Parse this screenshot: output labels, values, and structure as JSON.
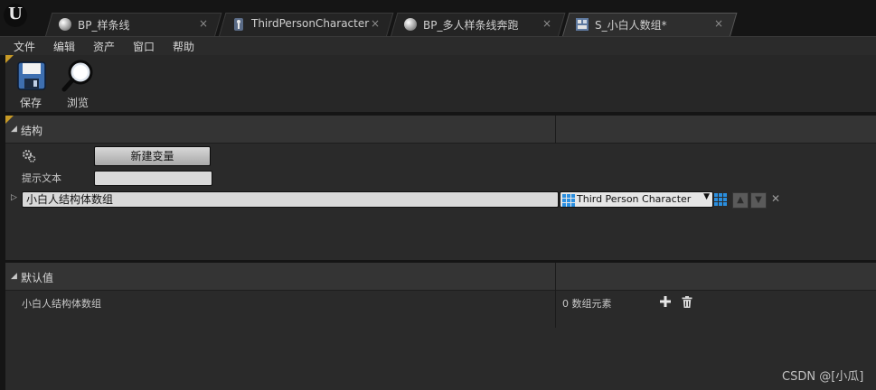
{
  "tabs": [
    {
      "label": "BP_样条线",
      "icon": "blueprint-orb-icon",
      "active": false
    },
    {
      "label": "ThirdPersonCharacter",
      "icon": "character-icon",
      "active": false
    },
    {
      "label": "BP_多人样条线奔跑",
      "icon": "blueprint-orb-icon",
      "active": false
    },
    {
      "label": "S_小白人数组*",
      "icon": "struct-icon",
      "active": true
    }
  ],
  "tab_close": "×",
  "menu": [
    "文件",
    "编辑",
    "资产",
    "窗口",
    "帮助"
  ],
  "toolbar": {
    "save_label": "保存",
    "browse_label": "浏览"
  },
  "structure_panel": {
    "title": "结构",
    "new_variable_label": "新建变量",
    "tooltip_label": "提示文本",
    "tooltip_value": "",
    "variable_name": "小白人结构体数组",
    "variable_type": "Third Person Character",
    "delete_glyph": "✕"
  },
  "defaults_panel": {
    "title": "默认值",
    "variable_name": "小白人结构体数组",
    "element_count": "0 数组元素"
  },
  "watermark": "CSDN @[小瓜]",
  "colors": {
    "accent": "#c79a27",
    "type_blue": "#2a8fe0"
  }
}
